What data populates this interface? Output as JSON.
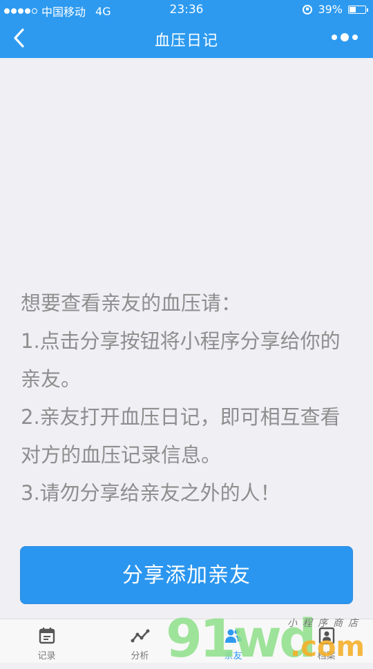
{
  "status_bar": {
    "carrier": "中国移动",
    "network": "4G",
    "time": "23:36",
    "battery": "39%",
    "battery_level": 0.39
  },
  "nav": {
    "title": "血压日记"
  },
  "instructions": {
    "heading": "想要查看亲友的血压请：",
    "lines": [
      "1.点击分享按钮将小程序分享给你的亲友。",
      "2.亲友打开血压日记，即可相互查看对方的血压记录信息。",
      "3.请勿分享给亲友之外的人！"
    ]
  },
  "share_button": {
    "label": "分享添加亲友"
  },
  "tabs": [
    {
      "label": "记录",
      "icon": "calendar-icon"
    },
    {
      "label": "分析",
      "icon": "trend-line-icon"
    },
    {
      "label": "亲友",
      "icon": "friends-icon",
      "active": true
    },
    {
      "label": "档案",
      "icon": "profile-icon"
    }
  ],
  "watermark": {
    "digits": "91wd",
    "domain": ".com",
    "shop": "小程序商店"
  },
  "colors": {
    "primary": "#2D9AF0",
    "background": "#EFEFF4",
    "text_gray": "#8E8E8E",
    "tab_gray": "#7A7A7A"
  }
}
